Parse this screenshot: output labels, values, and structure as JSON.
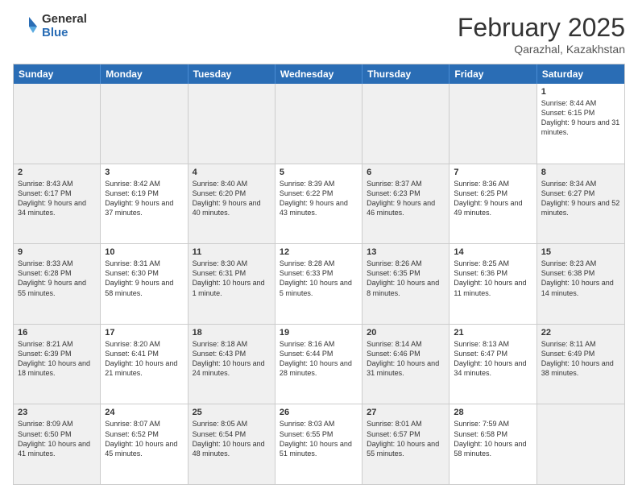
{
  "logo": {
    "general": "General",
    "blue": "Blue"
  },
  "header": {
    "month": "February 2025",
    "location": "Qarazhal, Kazakhstan"
  },
  "days_of_week": [
    "Sunday",
    "Monday",
    "Tuesday",
    "Wednesday",
    "Thursday",
    "Friday",
    "Saturday"
  ],
  "weeks": [
    [
      {
        "day": "",
        "info": "",
        "shaded": true
      },
      {
        "day": "",
        "info": "",
        "shaded": true
      },
      {
        "day": "",
        "info": "",
        "shaded": true
      },
      {
        "day": "",
        "info": "",
        "shaded": true
      },
      {
        "day": "",
        "info": "",
        "shaded": true
      },
      {
        "day": "",
        "info": "",
        "shaded": true
      },
      {
        "day": "1",
        "info": "Sunrise: 8:44 AM\nSunset: 6:15 PM\nDaylight: 9 hours and 31 minutes.",
        "shaded": false
      }
    ],
    [
      {
        "day": "2",
        "info": "Sunrise: 8:43 AM\nSunset: 6:17 PM\nDaylight: 9 hours and 34 minutes.",
        "shaded": true
      },
      {
        "day": "3",
        "info": "Sunrise: 8:42 AM\nSunset: 6:19 PM\nDaylight: 9 hours and 37 minutes.",
        "shaded": false
      },
      {
        "day": "4",
        "info": "Sunrise: 8:40 AM\nSunset: 6:20 PM\nDaylight: 9 hours and 40 minutes.",
        "shaded": true
      },
      {
        "day": "5",
        "info": "Sunrise: 8:39 AM\nSunset: 6:22 PM\nDaylight: 9 hours and 43 minutes.",
        "shaded": false
      },
      {
        "day": "6",
        "info": "Sunrise: 8:37 AM\nSunset: 6:23 PM\nDaylight: 9 hours and 46 minutes.",
        "shaded": true
      },
      {
        "day": "7",
        "info": "Sunrise: 8:36 AM\nSunset: 6:25 PM\nDaylight: 9 hours and 49 minutes.",
        "shaded": false
      },
      {
        "day": "8",
        "info": "Sunrise: 8:34 AM\nSunset: 6:27 PM\nDaylight: 9 hours and 52 minutes.",
        "shaded": true
      }
    ],
    [
      {
        "day": "9",
        "info": "Sunrise: 8:33 AM\nSunset: 6:28 PM\nDaylight: 9 hours and 55 minutes.",
        "shaded": true
      },
      {
        "day": "10",
        "info": "Sunrise: 8:31 AM\nSunset: 6:30 PM\nDaylight: 9 hours and 58 minutes.",
        "shaded": false
      },
      {
        "day": "11",
        "info": "Sunrise: 8:30 AM\nSunset: 6:31 PM\nDaylight: 10 hours and 1 minute.",
        "shaded": true
      },
      {
        "day": "12",
        "info": "Sunrise: 8:28 AM\nSunset: 6:33 PM\nDaylight: 10 hours and 5 minutes.",
        "shaded": false
      },
      {
        "day": "13",
        "info": "Sunrise: 8:26 AM\nSunset: 6:35 PM\nDaylight: 10 hours and 8 minutes.",
        "shaded": true
      },
      {
        "day": "14",
        "info": "Sunrise: 8:25 AM\nSunset: 6:36 PM\nDaylight: 10 hours and 11 minutes.",
        "shaded": false
      },
      {
        "day": "15",
        "info": "Sunrise: 8:23 AM\nSunset: 6:38 PM\nDaylight: 10 hours and 14 minutes.",
        "shaded": true
      }
    ],
    [
      {
        "day": "16",
        "info": "Sunrise: 8:21 AM\nSunset: 6:39 PM\nDaylight: 10 hours and 18 minutes.",
        "shaded": true
      },
      {
        "day": "17",
        "info": "Sunrise: 8:20 AM\nSunset: 6:41 PM\nDaylight: 10 hours and 21 minutes.",
        "shaded": false
      },
      {
        "day": "18",
        "info": "Sunrise: 8:18 AM\nSunset: 6:43 PM\nDaylight: 10 hours and 24 minutes.",
        "shaded": true
      },
      {
        "day": "19",
        "info": "Sunrise: 8:16 AM\nSunset: 6:44 PM\nDaylight: 10 hours and 28 minutes.",
        "shaded": false
      },
      {
        "day": "20",
        "info": "Sunrise: 8:14 AM\nSunset: 6:46 PM\nDaylight: 10 hours and 31 minutes.",
        "shaded": true
      },
      {
        "day": "21",
        "info": "Sunrise: 8:13 AM\nSunset: 6:47 PM\nDaylight: 10 hours and 34 minutes.",
        "shaded": false
      },
      {
        "day": "22",
        "info": "Sunrise: 8:11 AM\nSunset: 6:49 PM\nDaylight: 10 hours and 38 minutes.",
        "shaded": true
      }
    ],
    [
      {
        "day": "23",
        "info": "Sunrise: 8:09 AM\nSunset: 6:50 PM\nDaylight: 10 hours and 41 minutes.",
        "shaded": true
      },
      {
        "day": "24",
        "info": "Sunrise: 8:07 AM\nSunset: 6:52 PM\nDaylight: 10 hours and 45 minutes.",
        "shaded": false
      },
      {
        "day": "25",
        "info": "Sunrise: 8:05 AM\nSunset: 6:54 PM\nDaylight: 10 hours and 48 minutes.",
        "shaded": true
      },
      {
        "day": "26",
        "info": "Sunrise: 8:03 AM\nSunset: 6:55 PM\nDaylight: 10 hours and 51 minutes.",
        "shaded": false
      },
      {
        "day": "27",
        "info": "Sunrise: 8:01 AM\nSunset: 6:57 PM\nDaylight: 10 hours and 55 minutes.",
        "shaded": true
      },
      {
        "day": "28",
        "info": "Sunrise: 7:59 AM\nSunset: 6:58 PM\nDaylight: 10 hours and 58 minutes.",
        "shaded": false
      },
      {
        "day": "",
        "info": "",
        "shaded": true
      }
    ]
  ]
}
